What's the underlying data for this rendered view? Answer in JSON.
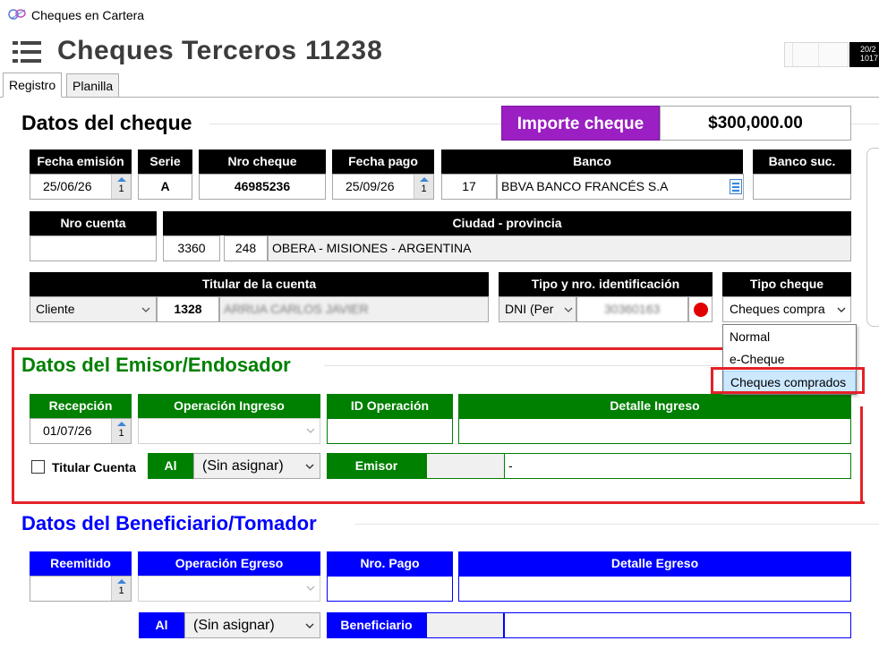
{
  "window": {
    "title": "Cheques en Cartera"
  },
  "header": {
    "title": "Cheques Terceros",
    "number": "11238",
    "clock": {
      "line1": "20/2",
      "line2": "1017"
    }
  },
  "tabs": [
    {
      "label": "Registro",
      "active": true
    },
    {
      "label": "Planilla",
      "active": false
    }
  ],
  "cheque": {
    "section_title": "Datos del cheque",
    "importe_label": "Importe cheque",
    "importe_value": "$300,000.00",
    "headers": {
      "fecha_emision": "Fecha emisión",
      "serie": "Serie",
      "nro_cheque": "Nro cheque",
      "fecha_pago": "Fecha pago",
      "banco": "Banco",
      "banco_suc": "Banco suc.",
      "nro_cuenta": "Nro cuenta",
      "ciudad": "Ciudad - provincia",
      "titular": "Titular de la cuenta",
      "tipo_id": "Tipo y nro. identificación",
      "tipo_cheque": "Tipo cheque"
    },
    "fecha_emision": "25/06/26",
    "fecha_emision_spin": "1",
    "serie": "A",
    "nro_cheque": "46985236",
    "fecha_pago": "25/09/26",
    "fecha_pago_spin": "1",
    "banco_code": "17",
    "banco_name": "BBVA BANCO FRANCÉS S.A",
    "banco_suc": "",
    "nro_cuenta": "",
    "ciudad_code1": "3360",
    "ciudad_code2": "248",
    "ciudad_name": "OBERA - MISIONES - ARGENTINA",
    "titular_tipo": "Cliente",
    "titular_code": "1328",
    "titular_nombre": "ARRUA CARLOS JAVIER",
    "tipo_id": "DNI (Per",
    "nro_id": "30360163",
    "tipo_cheque": "Cheques compra",
    "tipo_cheque_options": [
      "Normal",
      "e-Cheque",
      "Cheques comprados"
    ]
  },
  "emisor": {
    "section_title": "Datos del Emisor/Endosador",
    "headers": {
      "recepcion": "Recepción",
      "operacion": "Operación Ingreso",
      "id_operacion": "ID Operación",
      "detalle": "Detalle Ingreso"
    },
    "recepcion": "01/07/26",
    "recepcion_spin": "1",
    "operacion": "",
    "id_operacion": "",
    "detalle": "",
    "titular_cuenta_label": "Titular Cuenta",
    "al_label": "Al",
    "al_value": "(Sin asignar)",
    "emisor_label": "Emisor",
    "emisor_code": "",
    "emisor_name": "-"
  },
  "beneficiario": {
    "section_title": "Datos del Beneficiario/Tomador",
    "headers": {
      "reemitido": "Reemitido",
      "operacion": "Operación Egreso",
      "nro_pago": "Nro. Pago",
      "detalle": "Detalle Egreso"
    },
    "reemitido": "",
    "reemitido_spin": "1",
    "operacion": "",
    "nro_pago": "",
    "detalle": "",
    "al_label": "Al",
    "al_value": "(Sin asignar)",
    "beneficiario_label": "Beneficiario",
    "beneficiario_code": "",
    "beneficiario_name": ""
  },
  "colors": {
    "black_header": "#000000",
    "green": "#008000",
    "blue": "#0000ff",
    "purple": "#9b1fc2",
    "highlight_red": "#e32228"
  }
}
